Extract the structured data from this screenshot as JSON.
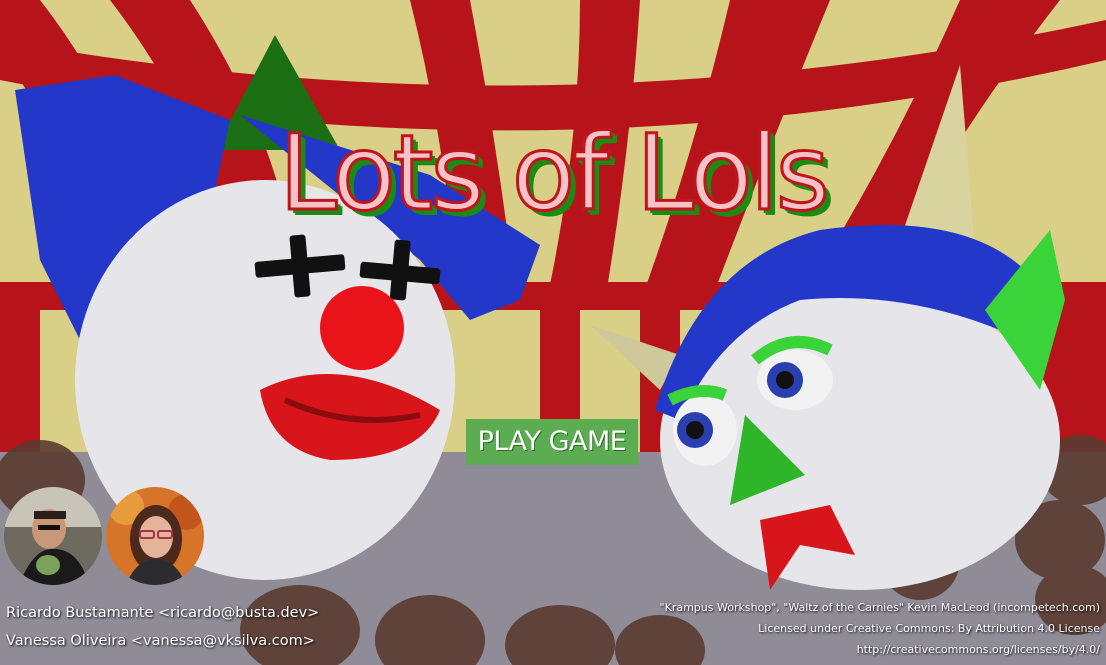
{
  "game": {
    "title": "Lots of Lols",
    "play_button": "PLAY GAME"
  },
  "authors": [
    {
      "name": "Ricardo Bustamante <ricardo@busta.dev>"
    },
    {
      "name": "Vanessa Oliveira <vanessa@vksilva.com>"
    }
  ],
  "music_credits": {
    "line1": "\"Krampus Workshop\", \"Waltz of the Carnies\" Kevin MacLeod (incompetech.com)",
    "line2": "Licensed under Creative Commons: By Attribution 4.0 License",
    "line3": "http://creativecommons.org/licenses/by/4.0/"
  },
  "colors": {
    "tent_red": "#c0141a",
    "tent_cream": "#d9cf86",
    "clown_blue": "#2338c9",
    "title_pink": "#f6c3c8",
    "button_green": "#5cac52"
  }
}
